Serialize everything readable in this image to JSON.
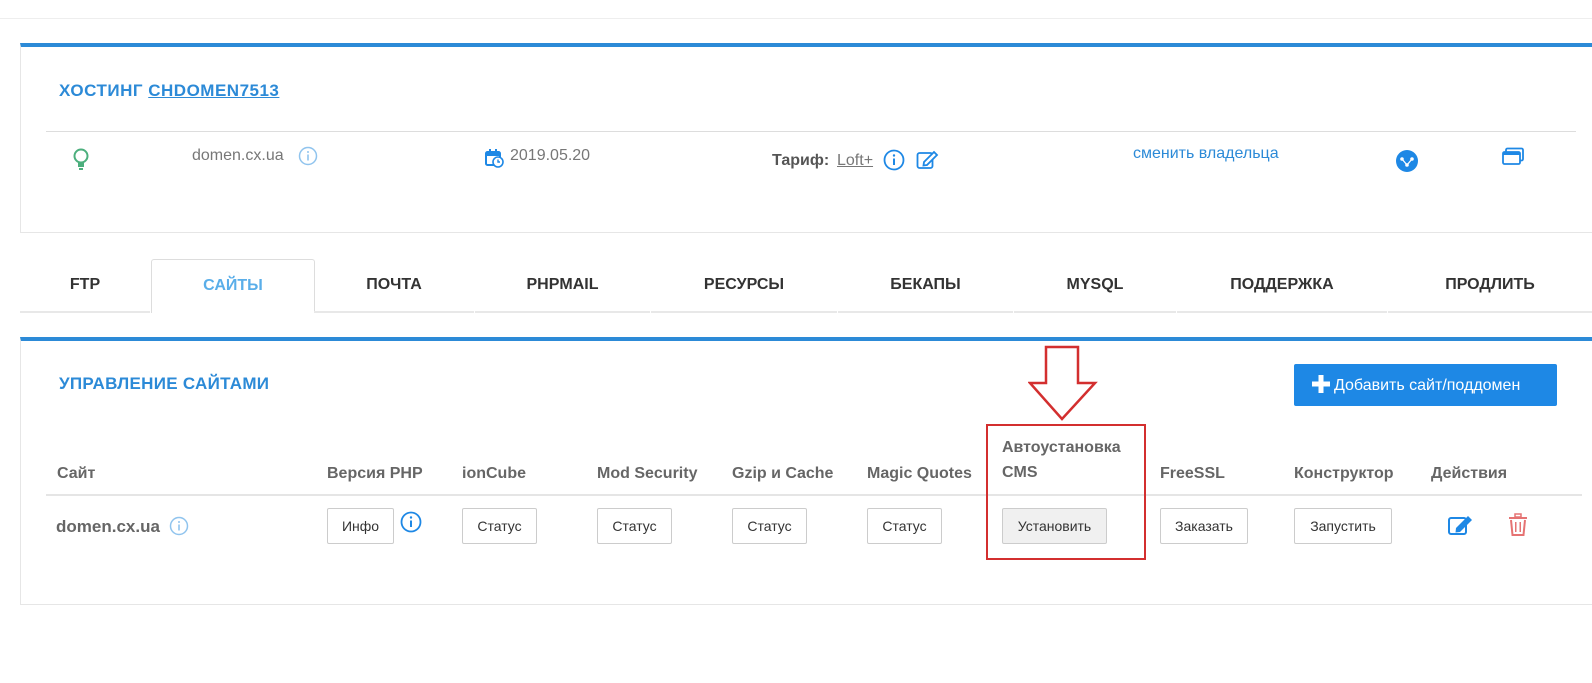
{
  "hosting": {
    "title_prefix": "ХОСТИНГ",
    "account": "CHDOMEN7513",
    "domain": "domen.cx.ua",
    "date": "2019.05.20",
    "tariff_label": "Тариф:",
    "tariff_value": "Loft+",
    "change_owner": "сменить владельца"
  },
  "tabs": [
    {
      "label": "FTP"
    },
    {
      "label": "САЙТЫ",
      "active": true
    },
    {
      "label": "ПОЧТА"
    },
    {
      "label": "PHPMAIL"
    },
    {
      "label": "РЕСУРСЫ"
    },
    {
      "label": "БЕКАПЫ"
    },
    {
      "label": "MYSQL"
    },
    {
      "label": "ПОДДЕРЖКА"
    },
    {
      "label": "ПРОДЛИТЬ"
    }
  ],
  "sites": {
    "title": "УПРАВЛЕНИЕ САЙТАМИ",
    "add_button": "Добавить сайт/поддомен",
    "columns": [
      "Сайт",
      "Версия PHP",
      "ionCube",
      "Mod Security",
      "Gzip и Cache",
      "Magic Quotes",
      "Автоустановка CMS",
      "FreeSSL",
      "Конструктор",
      "Действия"
    ],
    "row": {
      "site": "domen.cx.ua",
      "php": "Инфо",
      "ioncube": "Статус",
      "modsec": "Статус",
      "gzip": "Статус",
      "magic": "Статус",
      "cms": "Установить",
      "freessl": "Заказать",
      "constructor": "Запустить"
    }
  },
  "colors": {
    "accent": "#2c8ad7",
    "button": "#1e88e5",
    "annotation": "#d32f2f",
    "delete": "#e57373",
    "bulb": "#4caf7d"
  }
}
